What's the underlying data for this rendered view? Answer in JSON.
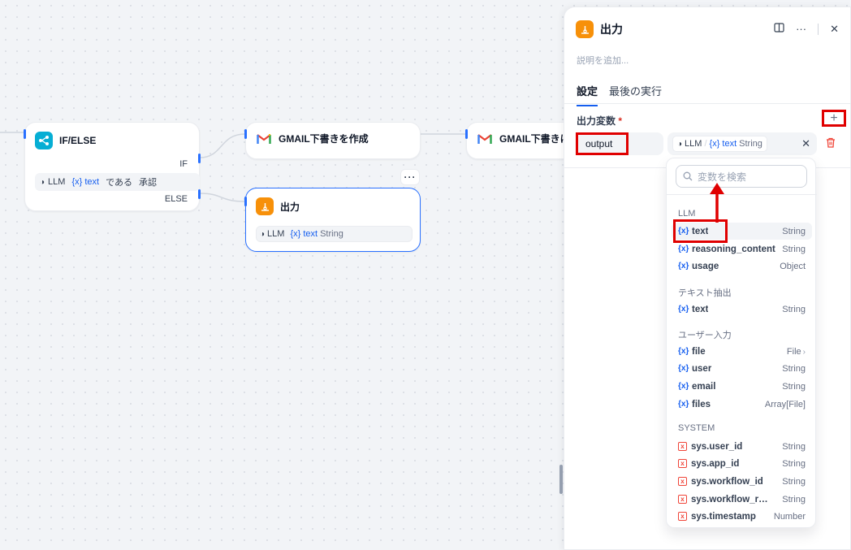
{
  "canvas": {
    "ifelse_node": {
      "title": "IF/ELSE",
      "if_label": "IF",
      "else_label": "ELSE",
      "condition": {
        "source": "LLM",
        "variable": "{x} text",
        "operator": "である",
        "value": "承認"
      }
    },
    "gmail_node_1": {
      "title": "GMAIL下書きを作成"
    },
    "gmail_node_2": {
      "title": "GMAIL下書きに"
    },
    "output_node": {
      "title": "出力",
      "source": "LLM",
      "variable": "{x} text",
      "type": "String",
      "more": "···"
    }
  },
  "panel": {
    "title": "出力",
    "description_placeholder": "説明を追加...",
    "tabs": [
      {
        "label": "設定",
        "active": true
      },
      {
        "label": "最後の実行",
        "active": false
      }
    ],
    "field_label": "出力変数",
    "required_mark": "*",
    "add_symbol": "+",
    "variable_name": "output",
    "value": {
      "source": "LLM",
      "separator": "/",
      "variable": "{x} text",
      "type": "String"
    }
  },
  "dropdown": {
    "search_placeholder": "変数を検索",
    "groups": [
      {
        "title": "LLM",
        "items": [
          {
            "name": "text",
            "type": "String",
            "kind": "var",
            "highlight": true
          },
          {
            "name": "reasoning_content",
            "type": "String",
            "kind": "var"
          },
          {
            "name": "usage",
            "type": "Object",
            "kind": "var"
          }
        ]
      },
      {
        "title": "テキスト抽出",
        "items": [
          {
            "name": "text",
            "type": "String",
            "kind": "var"
          }
        ]
      },
      {
        "title": "ユーザー入力",
        "items": [
          {
            "name": "file",
            "type": "File",
            "kind": "var",
            "chevron": true
          },
          {
            "name": "user",
            "type": "String",
            "kind": "var"
          },
          {
            "name": "email",
            "type": "String",
            "kind": "var"
          },
          {
            "name": "files",
            "type": "Array[File]",
            "kind": "var"
          }
        ]
      },
      {
        "title": "SYSTEM",
        "items": [
          {
            "name": "sys.user_id",
            "type": "String",
            "kind": "sys"
          },
          {
            "name": "sys.app_id",
            "type": "String",
            "kind": "sys"
          },
          {
            "name": "sys.workflow_id",
            "type": "String",
            "kind": "sys"
          },
          {
            "name": "sys.workflow_run_id",
            "type": "String",
            "kind": "sys"
          },
          {
            "name": "sys.timestamp",
            "type": "Number",
            "kind": "sys"
          }
        ]
      }
    ]
  },
  "colors": {
    "accent": "#155eef",
    "annotation": "#e00000",
    "if_else_icon": "#06aed4",
    "output_icon": "#f79009"
  },
  "icons": [
    "if-else-icon",
    "gmail-icon",
    "output-icon",
    "book-icon",
    "more-icon",
    "close-icon",
    "trash-icon",
    "search-icon",
    "variable-icon",
    "system-var-icon",
    "llm-icon",
    "chevron-right-icon"
  ]
}
